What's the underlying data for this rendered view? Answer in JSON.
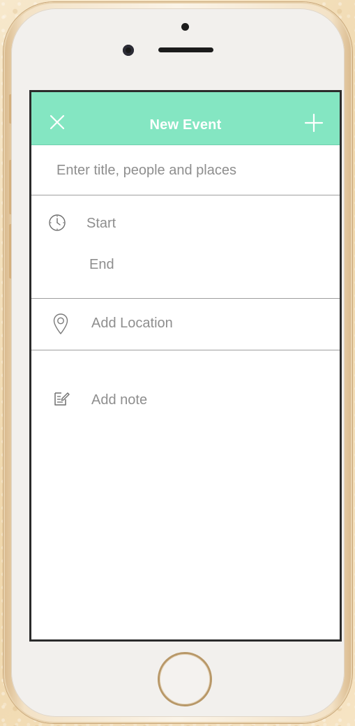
{
  "header": {
    "title": "New Event",
    "close_icon": "close-icon",
    "add_icon": "plus-icon"
  },
  "form": {
    "title_placeholder": "Enter title, people and places",
    "start_label": "Start",
    "end_label": "End",
    "location_label": "Add Location",
    "note_label": "Add note"
  },
  "colors": {
    "header_background": "#84e6c2",
    "header_text": "#ffffff",
    "placeholder_text": "#8e8e8e",
    "divider": "#9e9e9e"
  }
}
